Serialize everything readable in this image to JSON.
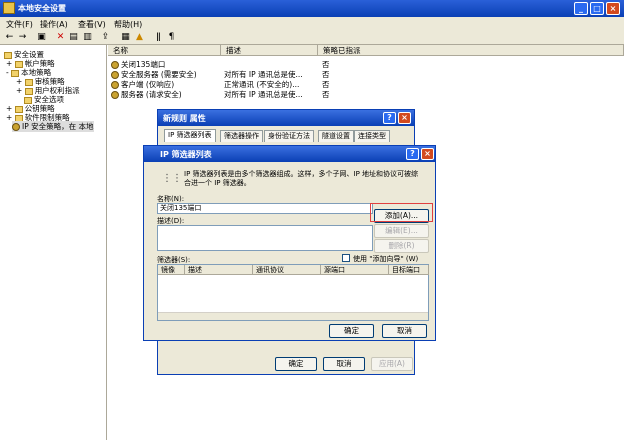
{
  "window": {
    "title": "本地安全设置",
    "min": "_",
    "max": "□",
    "close": "×"
  },
  "menu": [
    "文件(F)",
    "操作(A)",
    "查看(V)",
    "帮助(H)"
  ],
  "toolbar": [
    "←",
    "→",
    "▣",
    "✕",
    "▤",
    "▥",
    "⇪",
    "▦",
    "▲",
    "ǁ",
    "¶"
  ],
  "tree": [
    {
      "label": "安全设置"
    },
    {
      "label": "帐户策略",
      "exp": "+"
    },
    {
      "label": "本地策略",
      "exp": "-"
    },
    {
      "label": "审核策略",
      "exp": "+"
    },
    {
      "label": "用户权利指派",
      "exp": "+"
    },
    {
      "label": "安全选项"
    },
    {
      "label": "公钥策略",
      "exp": "+"
    },
    {
      "label": "软件限制策略",
      "exp": "+"
    },
    {
      "label": "IP 安全策略，在 本地"
    }
  ],
  "list": {
    "columns": [
      "名称",
      "描述",
      "策略已指派"
    ],
    "rows": [
      {
        "name": "关闭135端口",
        "desc": "",
        "assigned": "否"
      },
      {
        "name": "安全服务器 (需要安全)",
        "desc": "对所有 IP 通讯总是使...",
        "assigned": "否"
      },
      {
        "name": "客户端 (仅响应)",
        "desc": "正常通讯 (不安全的)...",
        "assigned": "否"
      },
      {
        "name": "服务器 (请求安全)",
        "desc": "对所有 IP 通讯总是使...",
        "assigned": "否"
      }
    ]
  },
  "props_dialog": {
    "title": "新规则 属性",
    "tabs": [
      "IP 筛选器列表",
      "筛选器操作",
      "身份验证方法",
      "隧道设置",
      "连接类型"
    ],
    "ok": "确定",
    "cancel": "取消",
    "apply": "应用(A)"
  },
  "filter_dialog": {
    "title": "IP 筛选器列表",
    "help": "?",
    "close": "×",
    "description": "IP 筛选器列表是由多个筛选器组成。这样，多个子网、IP 地址和协议可被综合进一个 IP 筛选器。",
    "name_label": "名称(N):",
    "name_value": "关闭135端口",
    "desc_label": "描述(D):",
    "add": "添加(A)...",
    "edit": "编辑(E)...",
    "remove": "删除(R)",
    "filters_label": "筛选器(S):",
    "wizard_label": "使用 \"添加向导\" (W)",
    "filter_columns": [
      "镜像",
      "描述",
      "通讯协议",
      "源端口",
      "目标端口"
    ],
    "ok": "确定",
    "cancel": "取消"
  }
}
